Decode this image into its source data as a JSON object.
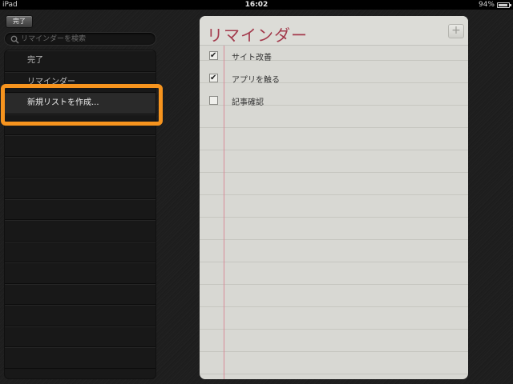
{
  "status_bar": {
    "device": "iPad",
    "time": "16:02",
    "battery": "94%",
    "battery_level": 0.94
  },
  "sidebar": {
    "done_label": "完了",
    "search_placeholder": "リマインダーを検索",
    "items": [
      {
        "label": "完了"
      },
      {
        "label": "リマインダー"
      },
      {
        "label": "新規リストを作成..."
      }
    ],
    "highlighted_index": 2,
    "highlight_color": "#f7941e"
  },
  "main": {
    "title": "リマインダー",
    "add_label": "+",
    "title_color": "#a33a4c",
    "tasks": [
      {
        "text": "サイト改善",
        "checked": true
      },
      {
        "text": "アプリを触る",
        "checked": true
      },
      {
        "text": "記事確認",
        "checked": false
      }
    ]
  }
}
